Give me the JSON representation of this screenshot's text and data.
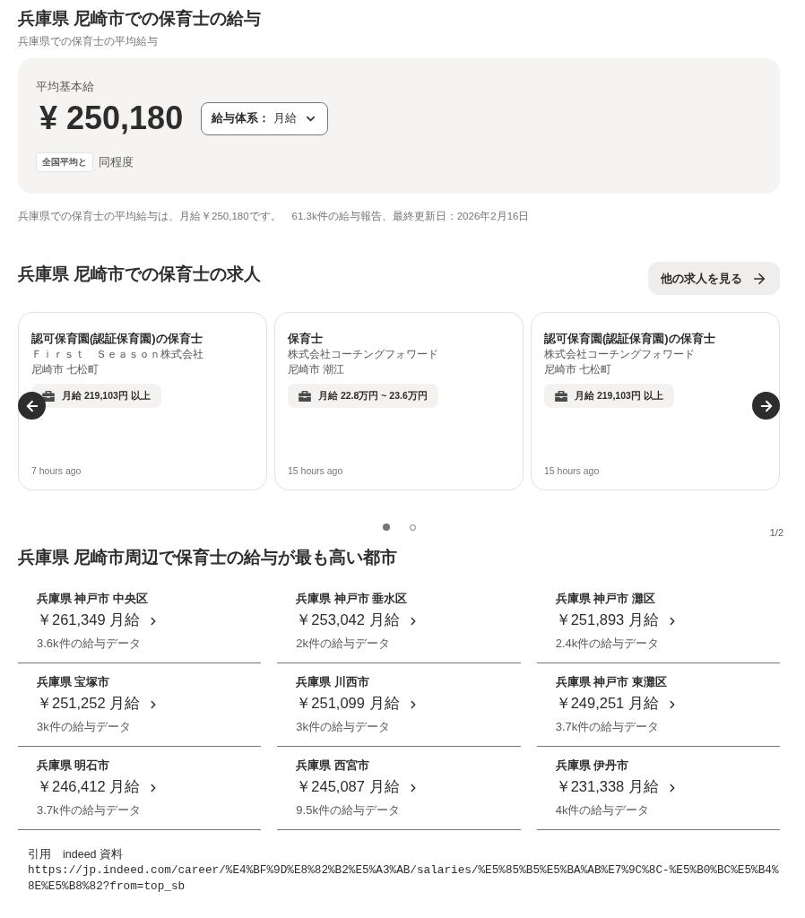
{
  "salary_section": {
    "title": "兵庫県 尼崎市での保育士の給与",
    "subtitle": "兵庫県での保育士の平均給与",
    "card": {
      "label": "平均基本給",
      "amount": "¥ 250,180",
      "pay_type": {
        "label": "給与体系：",
        "value": "月給"
      },
      "comparison": {
        "badge": "全国平均と",
        "text": "同程度"
      }
    },
    "summary": "兵庫県での保育士の平均給与は、月給￥250,180です。",
    "report": "61.3k件の給与報告、最終更新日：2026年2月16日"
  },
  "jobs_section": {
    "title": "兵庫県 尼崎市での保育士の求人",
    "more_button": "他の求人を見る",
    "jobs": [
      {
        "title": "認可保育園(認証保育園)の保育士",
        "company": "Ｆｉｒｓｔ　Ｓｅａｓｏｎ株式会社",
        "location": "尼崎市 七松町",
        "salary": "月給 219,103円 以上",
        "posted": "7 hours ago"
      },
      {
        "title": "保育士",
        "company": "株式会社コーチングフォワード",
        "location": "尼崎市 潮江",
        "salary": "月給 22.8万円 ~ 23.6万円",
        "posted": "15 hours ago"
      },
      {
        "title": "認可保育園(認証保育園)の保育士",
        "company": "株式会社コーチングフォワード",
        "location": "尼崎市 七松町",
        "salary": "月給 219,103円 以上",
        "posted": "15 hours ago"
      }
    ],
    "pagination": {
      "dots": [
        {
          "selected": true
        },
        {
          "selected": false
        }
      ],
      "page": "1/2"
    }
  },
  "cities_section": {
    "title": "兵庫県 尼崎市周辺で保育士の給与が最も高い都市",
    "cities": [
      {
        "location": "兵庫県 神戸市 中央区",
        "salary": "￥261,349 月給",
        "reports": "3.6k件の給与データ"
      },
      {
        "location": "兵庫県 神戸市 垂水区",
        "salary": "￥253,042 月給",
        "reports": "2k件の給与データ"
      },
      {
        "location": "兵庫県 神戸市 灘区",
        "salary": "￥251,893 月給",
        "reports": "2.4k件の給与データ"
      },
      {
        "location": "兵庫県 宝塚市",
        "salary": "￥251,252 月給",
        "reports": "3k件の給与データ"
      },
      {
        "location": "兵庫県 川西市",
        "salary": "￥251,099 月給",
        "reports": "3k件の給与データ"
      },
      {
        "location": "兵庫県 神戸市 東灘区",
        "salary": "￥249,251 月給",
        "reports": "3.7k件の給与データ"
      },
      {
        "location": "兵庫県 明石市",
        "salary": "￥246,412 月給",
        "reports": "3.7k件の給与データ"
      },
      {
        "location": "兵庫県 西宮市",
        "salary": "￥245,087 月給",
        "reports": "9.5k件の給与データ"
      },
      {
        "location": "兵庫県 伊丹市",
        "salary": "￥231,338 月給",
        "reports": "4k件の給与データ"
      }
    ]
  },
  "citation": {
    "label": "引用　indeed 資料",
    "url": "https://jp.indeed.com/career/%E4%BF%9D%E8%82%B2%E5%A3%AB/salaries/%E5%85%B5%E5%BA%AB%E7%9C%8C-%E5%B0%BC%E5%B4%8E%E5%B8%82?from=top_sb"
  }
}
